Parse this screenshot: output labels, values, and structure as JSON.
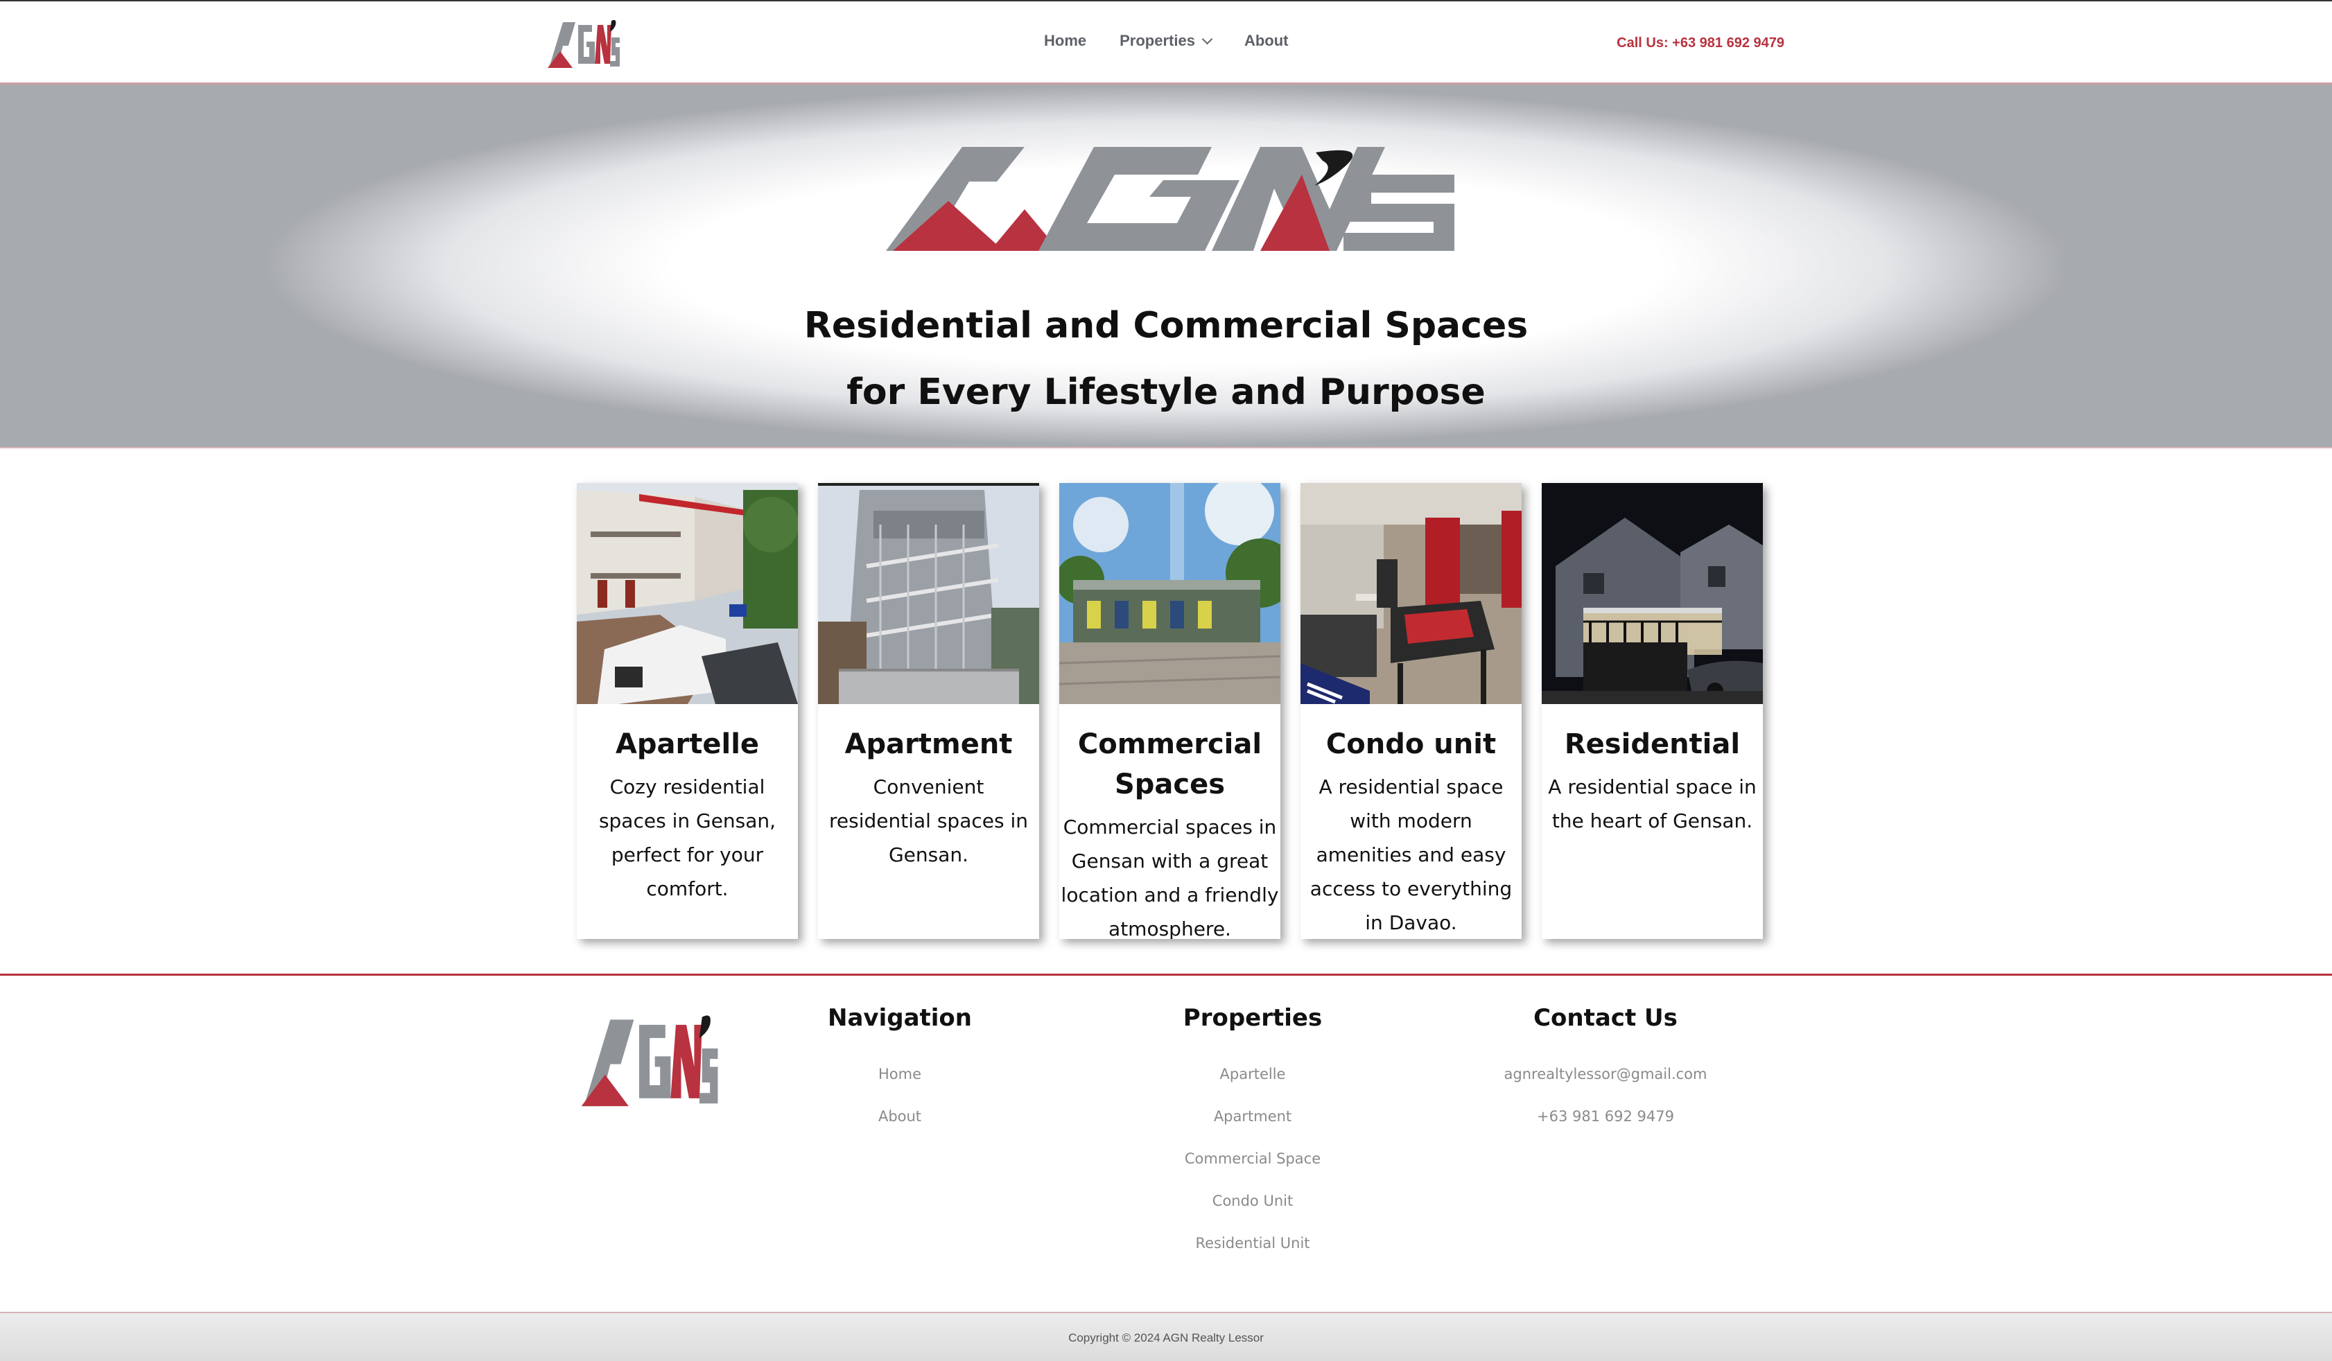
{
  "brand": {
    "logo_text": "AGN's",
    "colors": {
      "red": "#b8323f",
      "gray": "#8f9398"
    }
  },
  "header": {
    "nav": [
      {
        "label": "Home"
      },
      {
        "label": "Properties",
        "has_dropdown": true
      },
      {
        "label": "About"
      }
    ],
    "call_us": "Call Us: +63 981 692 9479"
  },
  "hero": {
    "title_line1": "Residential and Commercial Spaces",
    "title_line2": "for Every Lifestyle and Purpose"
  },
  "cards": [
    {
      "title": "Apartelle",
      "description": "Cozy residential spaces in Gensan, perfect for your comfort.",
      "image": "two-storey apartelle building with white pickup truck in driveway"
    },
    {
      "title": "Apartment",
      "description": "Convenient residential spaces in Gensan.",
      "image": "multi-level apartment with metal railings and stairs"
    },
    {
      "title": "Commercial Spaces",
      "description": "Commercial spaces in Gensan with a great location and a friendly atmosphere.",
      "image": "single-storey commercial building with gravel lot and trees"
    },
    {
      "title": "Condo unit",
      "description": "A residential space with modern amenities and easy access to everything in Davao.",
      "image": "condo interior with dining table, kitchen and red curtains"
    },
    {
      "title": "Residential",
      "description": "A residential space in the heart of Gensan.",
      "image": "residential house at night with gate and car"
    }
  ],
  "footer": {
    "navigation": {
      "heading": "Navigation",
      "links": [
        "Home",
        "About"
      ]
    },
    "properties": {
      "heading": "Properties",
      "links": [
        "Apartelle",
        "Apartment",
        "Commercial Space",
        "Condo Unit",
        "Residential Unit"
      ]
    },
    "contact": {
      "heading": "Contact Us",
      "email": "agnrealtylessor@gmail.com",
      "phone": "+63 981 692 9479"
    },
    "copyright": "Copyright © 2024 AGN Realty Lessor"
  }
}
